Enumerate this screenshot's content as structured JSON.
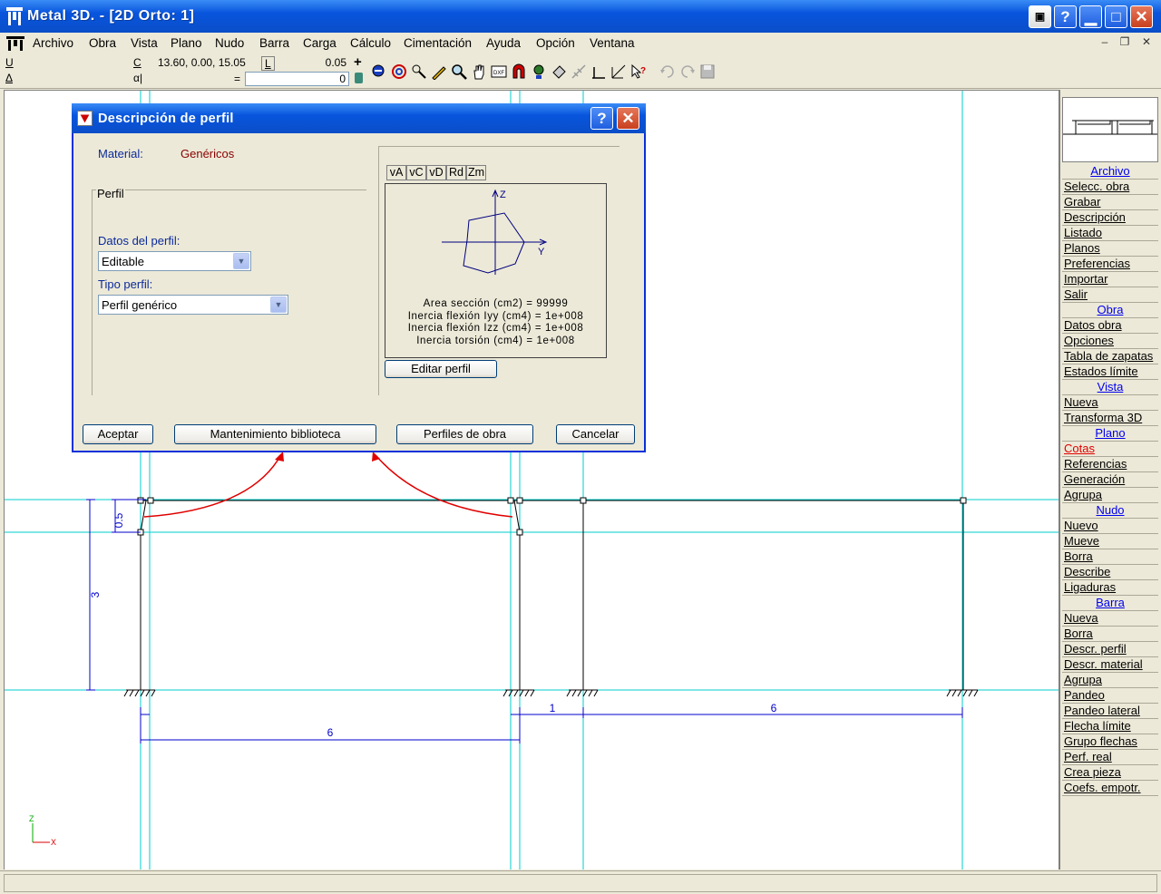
{
  "window": {
    "title": "Metal 3D. - [2D Orto: 1]"
  },
  "menubar": {
    "items": [
      "Archivo",
      "Obra",
      "Vista",
      "Plano",
      "Nudo",
      "Barra",
      "Carga",
      "Cálculo",
      "Cimentación",
      "Ayuda",
      "Opción",
      "Ventana"
    ]
  },
  "toolbar": {
    "u_label": "U",
    "delta_label": "Δ",
    "c_label": "C",
    "alpha_label": "α|",
    "coords": "13.60,  0.00, 15.05",
    "l_label": "L",
    "l_value": "0.05",
    "eq_label": "=",
    "slider_value": "0"
  },
  "dialog": {
    "title": "Descripción de perfil",
    "material_label": "Material:",
    "material_value": "Genéricos",
    "group_label": "Perfil",
    "datos_label": "Datos del perfil:",
    "datos_value": "Editable",
    "tipo_label": "Tipo perfil:",
    "tipo_value": "Perfil genérico",
    "tabs": [
      "vA",
      "vC",
      "vD",
      "Rd",
      "Zm"
    ],
    "axis_z": "Z",
    "axis_y": "Y",
    "props": [
      "Area sección (cm2) = 99999",
      "Inercia flexión Iyy (cm4) = 1e+008",
      "Inercia flexión Izz (cm4) = 1e+008",
      "Inercia torsión (cm4) = 1e+008"
    ],
    "edit_button": "Editar perfil",
    "buttons": {
      "accept": "Aceptar",
      "library": "Mantenimiento biblioteca",
      "work_profiles": "Perfiles de obra",
      "cancel": "Cancelar"
    }
  },
  "drawing": {
    "dim_05": "0.5",
    "dim_3": "3",
    "dim_6_left": "6",
    "dim_1": "1",
    "dim_6_right": "6",
    "axis_z": "Z",
    "axis_x": "X"
  },
  "sidemenu": {
    "sections": [
      {
        "title": "Archivo",
        "items": [
          "Selecc. obra",
          "Grabar",
          "Descripción",
          "Listado",
          "Planos",
          "Preferencias",
          "Importar",
          "Salir"
        ]
      },
      {
        "title": "Obra",
        "items": [
          "Datos obra",
          "Opciones",
          "Tabla de zapatas",
          "Estados límite"
        ]
      },
      {
        "title": "Vista",
        "items": [
          "Nueva",
          "Transforma 3D"
        ]
      },
      {
        "title": "Plano",
        "items": [
          "Cotas",
          "Referencias",
          "Generación",
          "Agrupa"
        ]
      },
      {
        "title": "Nudo",
        "items": [
          "Nuevo",
          "Mueve",
          "Borra",
          "Describe",
          "Ligaduras"
        ]
      },
      {
        "title": "Barra",
        "items": [
          "Nueva",
          "Borra",
          "Descr. perfil",
          "Descr. material",
          "Agrupa",
          "Pandeo",
          "Pandeo lateral",
          "Flecha límite",
          "Grupo flechas",
          "Perf. real",
          "Crea pieza",
          "Coefs. empotr."
        ]
      }
    ],
    "active_item": "Cotas"
  },
  "colors": {
    "titlebar": "#0a54d8",
    "guide": "#00cccc",
    "dimension": "#0000cc",
    "arrow": "#e00000"
  }
}
